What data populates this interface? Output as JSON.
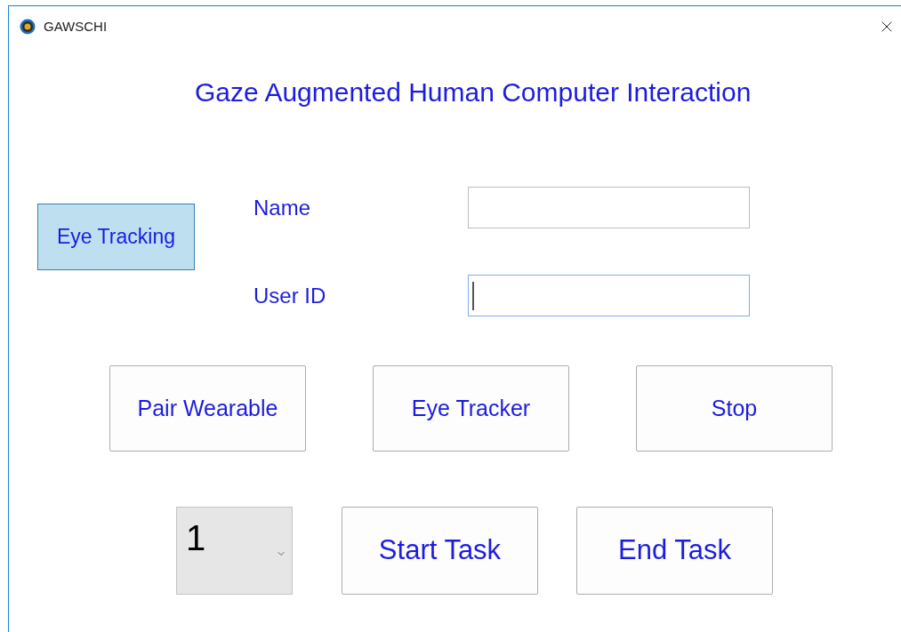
{
  "window": {
    "title": "GAWSCHI"
  },
  "heading": "Gaze Augmented Human Computer Interaction",
  "mode_button": {
    "label": "Eye Tracking",
    "selected": true
  },
  "fields": [
    {
      "label": "Name",
      "focused": false
    },
    {
      "label": "User ID",
      "focused": true
    }
  ],
  "buttons": [
    "Pair Wearable",
    "Eye Tracker",
    "Stop"
  ],
  "task_selector": {
    "value": "1"
  },
  "task_buttons": [
    "Start Task",
    "End Task"
  ]
}
